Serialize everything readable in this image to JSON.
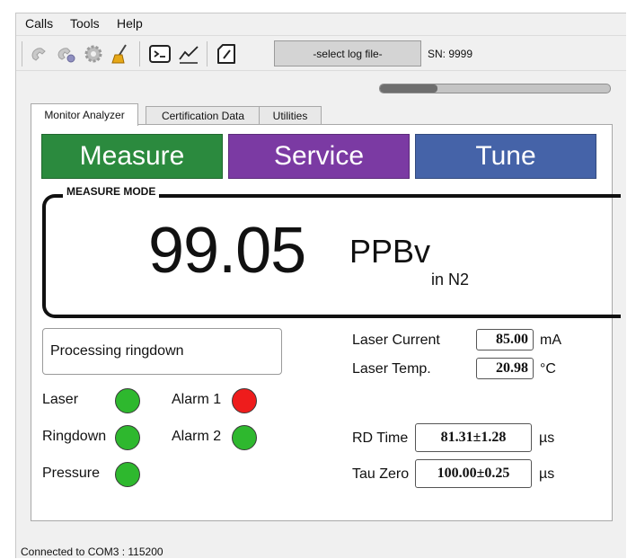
{
  "menu": {
    "items": [
      "Calls",
      "Tools",
      "Help"
    ]
  },
  "toolbar": {
    "icons": [
      "phone-disabled-icon",
      "phone-settings-icon",
      "gear-icon",
      "broom-icon",
      "terminal-icon",
      "chart-line-icon",
      "edit-note-icon"
    ],
    "log_file_button": "-select log file-",
    "serial_number": "SN: 9999"
  },
  "progress": {
    "fraction": 0.25
  },
  "tabs": [
    "Monitor Analyzer",
    "Certification Data",
    "Utilities"
  ],
  "modes": {
    "measure": {
      "label": "Measure",
      "color": "#2b8a3e"
    },
    "service": {
      "label": "Service",
      "color": "#7b3aa3"
    },
    "tune": {
      "label": "Tune",
      "color": "#4563a8"
    }
  },
  "measurement": {
    "mode_label": "MEASURE MODE",
    "value": "99.05",
    "unit": "PPBv",
    "unit_sub": "in N2"
  },
  "status_text": "Processing ringdown",
  "indicators": [
    {
      "label": "Laser",
      "color": "#2eb82e"
    },
    {
      "label": "Ringdown",
      "color": "#2eb82e"
    },
    {
      "label": "Pressure",
      "color": "#2eb82e"
    },
    {
      "label": "Alarm 1",
      "color": "#ee1c1c"
    },
    {
      "label": "Alarm 2",
      "color": "#2eb82e"
    }
  ],
  "readings": {
    "laser_current": {
      "label": "Laser Current",
      "value": "85.00",
      "unit": "mA"
    },
    "laser_temp": {
      "label": "Laser Temp.",
      "value": "20.98",
      "unit": "°C"
    },
    "rd_time": {
      "label": "RD Time",
      "value": "81.31±1.28",
      "unit": "µs"
    },
    "tau_zero": {
      "label": "Tau Zero",
      "value": "100.00±0.25",
      "unit": "µs"
    }
  },
  "statusbar": {
    "text": "Connected to COM3 : 115200"
  }
}
